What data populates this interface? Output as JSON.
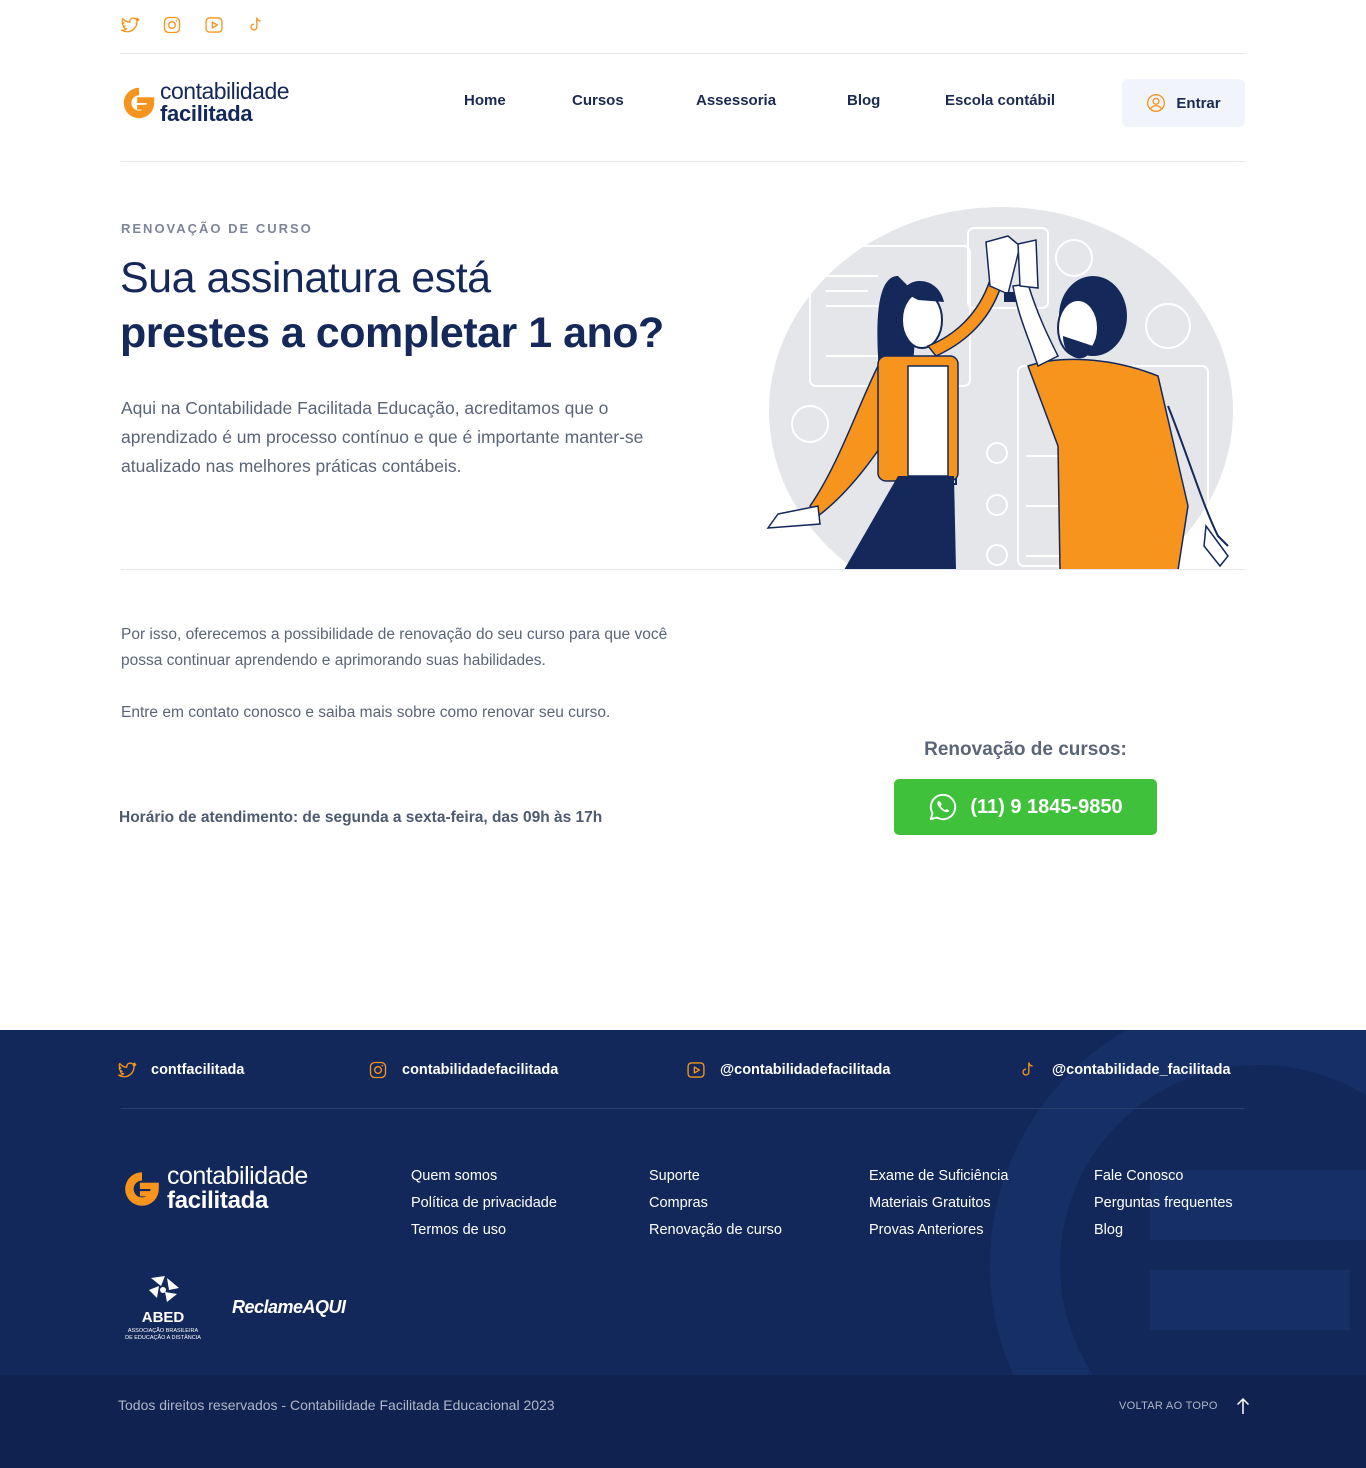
{
  "top_social": {
    "icons": [
      "twitter-icon",
      "instagram-icon",
      "youtube-icon",
      "tiktok-icon"
    ],
    "accent": "#f7941d"
  },
  "logo": {
    "line1": "contabilidade",
    "line2": "facilitada"
  },
  "nav": {
    "items": [
      "Home",
      "Cursos",
      "Assessoria",
      "Blog",
      "Escola contábil"
    ],
    "login_label": "Entrar"
  },
  "hero": {
    "eyebrow": "RENOVAÇÃO DE CURSO",
    "title_line1": "Sua assinatura está",
    "title_line2": "prestes a completar 1 ano?",
    "intro": "Aqui na Contabilidade Facilitada Educação, acreditamos que o aprendizado é um processo contínuo e que é importante manter-se atualizado nas melhores práticas contábeis."
  },
  "body": {
    "paragraph1": "Por isso, oferecemos a possibilidade de renovação do seu curso para que você possa continuar aprendendo e aprimorando suas habilidades.",
    "paragraph2": "Entre em contato conosco e saiba mais sobre como renovar seu curso.",
    "hours": "Horário de atendimento: de segunda a sexta-feira, das 09h às 17h",
    "renewal_title": "Renovação de cursos:",
    "whatsapp_number": "(11) 9 1845-9850",
    "whatsapp_color": "#40c13b"
  },
  "footer": {
    "social": [
      {
        "icon": "twitter-icon",
        "handle": "contfacilitada"
      },
      {
        "icon": "instagram-icon",
        "handle": "contabilidadefacilitada"
      },
      {
        "icon": "youtube-icon",
        "handle": "@contabilidadefacilitada"
      },
      {
        "icon": "tiktok-icon",
        "handle": "@contabilidade_facilitada"
      }
    ],
    "logo": {
      "line1": "contabilidade",
      "line2": "facilitada"
    },
    "columns": [
      [
        "Quem somos",
        "Política de privacidade",
        "Termos de uso"
      ],
      [
        "Suporte",
        "Compras",
        "Renovação de curso"
      ],
      [
        "Exame de Suficiência",
        "Materiais Gratuitos",
        "Provas Anteriores"
      ],
      [
        "Fale Conosco",
        "Perguntas frequentes",
        "Blog"
      ]
    ],
    "abed": {
      "name": "ABED",
      "subtitle_line1": "ASSOCIAÇÃO BRASILEIRA",
      "subtitle_line2": "DE EDUCAÇÃO A DISTÂNCIA"
    },
    "reclame": "ReclameAQUI",
    "copyright": "Todos direitos reservados - Contabilidade Facilitada Educacional 2023",
    "back_to_top": "VOLTAR AO TOPO",
    "background": "#12285a"
  }
}
